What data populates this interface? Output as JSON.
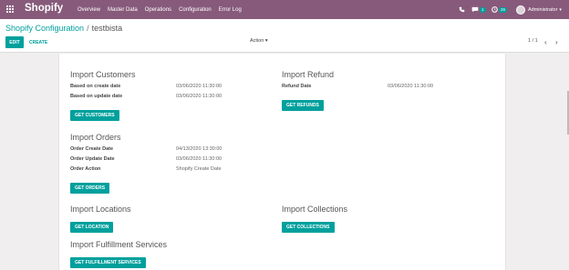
{
  "topbar": {
    "brand": "Shopify",
    "menu": [
      "Overview",
      "Master Data",
      "Operations",
      "Configuration",
      "Error Log"
    ],
    "messages_count": "1",
    "activity_count": "26",
    "user_name": "Administrator"
  },
  "breadcrumb": {
    "parent": "Shopify Configuration",
    "separator": "/",
    "current": "testbista"
  },
  "buttons": {
    "edit": "EDIT",
    "create": "CREATE",
    "action": "Action ▾"
  },
  "pager": {
    "value": "1 / 1",
    "prev": "‹",
    "next": "›"
  },
  "sections": {
    "customers": {
      "title": "Import Customers",
      "rows": [
        {
          "label": "Based on create date",
          "value": "03/06/2020 11:30:00"
        },
        {
          "label": "Based on update date",
          "value": "03/06/2020 11:30:00"
        }
      ],
      "button": "GET CUSTOMERS"
    },
    "refund": {
      "title": "Import Refund",
      "rows": [
        {
          "label": "Refund Date",
          "value": "03/06/2020 11:30:00"
        }
      ],
      "button": "GET REFUNDS"
    },
    "orders": {
      "title": "Import Orders",
      "rows": [
        {
          "label": "Order Create Date",
          "value": "04/13/2020 13:30:00"
        },
        {
          "label": "Order Update Date",
          "value": "03/06/2020 11:30:00"
        },
        {
          "label": "Order Action",
          "value": "Shopify Create Date"
        }
      ],
      "button": "GET ORDERS"
    },
    "locations": {
      "title": "Import Locations",
      "button": "GET LOCATION"
    },
    "collections": {
      "title": "Import Collections",
      "button": "GET COLLECTIONS"
    },
    "fulfillment": {
      "title": "Import Fulfillment Services",
      "button": "GET FULFILLMENT SERVICES"
    }
  },
  "colors": {
    "navbar": "#875a7b",
    "accent": "#00a09d"
  }
}
